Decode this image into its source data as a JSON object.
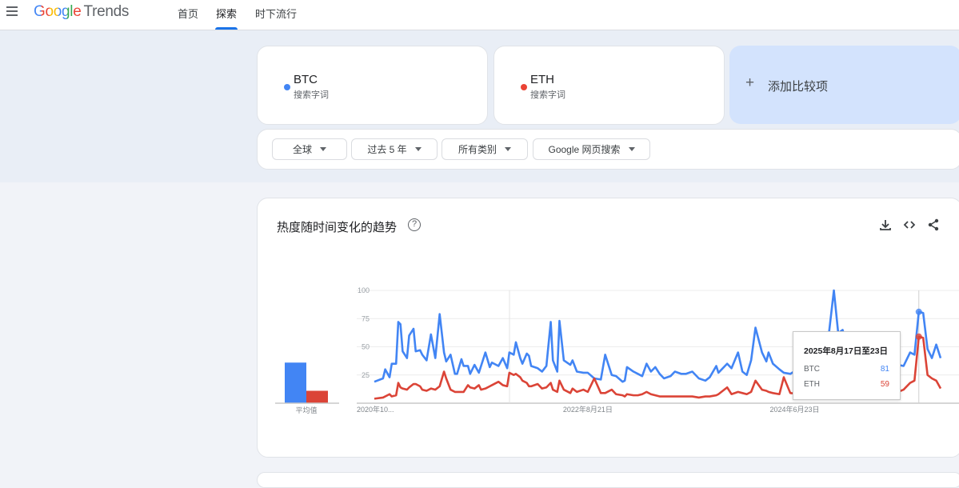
{
  "header": {
    "brand_google": "Google",
    "brand_trends": "Trends",
    "nav": [
      "首页",
      "探索",
      "时下流行"
    ],
    "active_nav": 1
  },
  "terms": [
    {
      "name": "BTC",
      "sub": "搜索字词",
      "color": "#4285f4"
    },
    {
      "name": "ETH",
      "sub": "搜索字词",
      "color": "#ea4335"
    }
  ],
  "add_compare": {
    "icon": "plus-icon",
    "label": "添加比较项"
  },
  "filters": [
    "全球",
    "过去 5 年",
    "所有类别",
    "Google 网页搜索"
  ],
  "trend_card": {
    "title": "热度随时间变化的趋势",
    "help": "?",
    "actions": [
      "download-icon",
      "embed-icon",
      "share-icon"
    ]
  },
  "tooltip": {
    "date": "2025年8月17日至23日",
    "rows": [
      {
        "name": "BTC",
        "value": "81"
      },
      {
        "name": "ETH",
        "value": "59"
      }
    ]
  },
  "chart_data": {
    "type": "line",
    "title": "热度随时间变化的趋势",
    "xlabel": "",
    "ylabel": "",
    "ylim": [
      0,
      100
    ],
    "yticks": [
      "100",
      "75",
      "50",
      "25"
    ],
    "xticks": [
      {
        "week": 0,
        "label": "2020年10..."
      },
      {
        "week": 98,
        "label": "2022年8月21日"
      },
      {
        "week": 193,
        "label": "2024年6月23日"
      }
    ],
    "x_weeks_total": 260,
    "hover_week": 250,
    "grid": true,
    "average": {
      "label": "平均值",
      "values": [
        {
          "name": "BTC",
          "value": 36
        },
        {
          "name": "ETH",
          "value": 11
        }
      ]
    },
    "series": [
      {
        "name": "BTC",
        "color": "#4285f4",
        "points": [
          [
            0,
            19
          ],
          [
            4,
            22
          ],
          [
            5,
            30
          ],
          [
            7,
            23
          ],
          [
            8,
            35
          ],
          [
            10,
            35
          ],
          [
            11,
            72
          ],
          [
            12,
            70
          ],
          [
            13,
            46
          ],
          [
            15,
            40
          ],
          [
            16,
            60
          ],
          [
            18,
            66
          ],
          [
            19,
            46
          ],
          [
            21,
            47
          ],
          [
            22,
            43
          ],
          [
            24,
            38
          ],
          [
            26,
            61
          ],
          [
            28,
            40
          ],
          [
            30,
            79
          ],
          [
            32,
            45
          ],
          [
            33,
            37
          ],
          [
            35,
            43
          ],
          [
            37,
            26
          ],
          [
            38,
            26
          ],
          [
            40,
            39
          ],
          [
            41,
            33
          ],
          [
            43,
            33
          ],
          [
            44,
            26
          ],
          [
            46,
            34
          ],
          [
            48,
            27
          ],
          [
            49,
            33
          ],
          [
            51,
            45
          ],
          [
            53,
            32
          ],
          [
            54,
            36
          ],
          [
            57,
            33
          ],
          [
            59,
            40
          ],
          [
            61,
            31
          ],
          [
            62,
            45
          ],
          [
            64,
            43
          ],
          [
            65,
            54
          ],
          [
            67,
            40
          ],
          [
            68,
            35
          ],
          [
            70,
            44
          ],
          [
            71,
            42
          ],
          [
            72,
            33
          ],
          [
            75,
            31
          ],
          [
            77,
            28
          ],
          [
            79,
            33
          ],
          [
            81,
            72
          ],
          [
            82,
            38
          ],
          [
            84,
            28
          ],
          [
            85,
            73
          ],
          [
            87,
            38
          ],
          [
            90,
            34
          ],
          [
            91,
            38
          ],
          [
            93,
            28
          ],
          [
            96,
            27
          ],
          [
            98,
            27
          ],
          [
            101,
            22
          ],
          [
            104,
            21
          ],
          [
            106,
            43
          ],
          [
            109,
            25
          ],
          [
            111,
            24
          ],
          [
            114,
            19
          ],
          [
            115,
            20
          ],
          [
            116,
            32
          ],
          [
            119,
            28
          ],
          [
            121,
            26
          ],
          [
            123,
            24
          ],
          [
            125,
            35
          ],
          [
            127,
            28
          ],
          [
            129,
            32
          ],
          [
            131,
            26
          ],
          [
            133,
            22
          ],
          [
            136,
            24
          ],
          [
            138,
            28
          ],
          [
            141,
            26
          ],
          [
            143,
            26
          ],
          [
            146,
            28
          ],
          [
            149,
            22
          ],
          [
            152,
            20
          ],
          [
            154,
            23
          ],
          [
            157,
            33
          ],
          [
            158,
            27
          ],
          [
            162,
            35
          ],
          [
            164,
            31
          ],
          [
            167,
            45
          ],
          [
            169,
            28
          ],
          [
            171,
            25
          ],
          [
            173,
            38
          ],
          [
            175,
            67
          ],
          [
            178,
            45
          ],
          [
            180,
            37
          ],
          [
            181,
            45
          ],
          [
            183,
            35
          ],
          [
            186,
            30
          ],
          [
            188,
            27
          ],
          [
            191,
            26
          ],
          [
            196,
            32
          ],
          [
            201,
            38
          ],
          [
            207,
            33
          ],
          [
            211,
            100
          ],
          [
            213,
            62
          ],
          [
            215,
            65
          ],
          [
            218,
            45
          ],
          [
            222,
            40
          ],
          [
            227,
            38
          ],
          [
            233,
            42
          ],
          [
            238,
            35
          ],
          [
            243,
            33
          ],
          [
            246,
            45
          ],
          [
            248,
            43
          ],
          [
            250,
            81
          ],
          [
            252,
            80
          ],
          [
            254,
            48
          ],
          [
            256,
            40
          ],
          [
            258,
            52
          ],
          [
            260,
            40
          ]
        ]
      },
      {
        "name": "ETH",
        "color": "#db4437",
        "points": [
          [
            0,
            4
          ],
          [
            4,
            5
          ],
          [
            7,
            8
          ],
          [
            8,
            6
          ],
          [
            10,
            7
          ],
          [
            11,
            18
          ],
          [
            12,
            14
          ],
          [
            13,
            13
          ],
          [
            15,
            12
          ],
          [
            16,
            14
          ],
          [
            18,
            17
          ],
          [
            19,
            17
          ],
          [
            21,
            15
          ],
          [
            22,
            12
          ],
          [
            24,
            11
          ],
          [
            26,
            13
          ],
          [
            28,
            12
          ],
          [
            30,
            15
          ],
          [
            32,
            28
          ],
          [
            33,
            22
          ],
          [
            35,
            12
          ],
          [
            37,
            10
          ],
          [
            38,
            10
          ],
          [
            40,
            10
          ],
          [
            41,
            10
          ],
          [
            43,
            16
          ],
          [
            44,
            14
          ],
          [
            46,
            13
          ],
          [
            48,
            16
          ],
          [
            49,
            12
          ],
          [
            51,
            13
          ],
          [
            53,
            15
          ],
          [
            54,
            16
          ],
          [
            57,
            19
          ],
          [
            59,
            16
          ],
          [
            61,
            15
          ],
          [
            62,
            27
          ],
          [
            64,
            25
          ],
          [
            65,
            26
          ],
          [
            67,
            23
          ],
          [
            68,
            20
          ],
          [
            70,
            18
          ],
          [
            71,
            15
          ],
          [
            72,
            15
          ],
          [
            75,
            17
          ],
          [
            77,
            13
          ],
          [
            79,
            14
          ],
          [
            81,
            18
          ],
          [
            82,
            12
          ],
          [
            84,
            10
          ],
          [
            85,
            20
          ],
          [
            87,
            12
          ],
          [
            90,
            9
          ],
          [
            91,
            13
          ],
          [
            93,
            10
          ],
          [
            96,
            12
          ],
          [
            98,
            10
          ],
          [
            101,
            22
          ],
          [
            104,
            9
          ],
          [
            106,
            9
          ],
          [
            109,
            12
          ],
          [
            111,
            8
          ],
          [
            114,
            7
          ],
          [
            115,
            6
          ],
          [
            116,
            8
          ],
          [
            119,
            7
          ],
          [
            121,
            7
          ],
          [
            123,
            8
          ],
          [
            125,
            10
          ],
          [
            127,
            8
          ],
          [
            129,
            7
          ],
          [
            131,
            6
          ],
          [
            133,
            6
          ],
          [
            136,
            6
          ],
          [
            138,
            6
          ],
          [
            141,
            6
          ],
          [
            143,
            6
          ],
          [
            146,
            6
          ],
          [
            149,
            5
          ],
          [
            152,
            6
          ],
          [
            154,
            6
          ],
          [
            157,
            7
          ],
          [
            158,
            8
          ],
          [
            162,
            14
          ],
          [
            164,
            8
          ],
          [
            167,
            10
          ],
          [
            169,
            9
          ],
          [
            171,
            8
          ],
          [
            173,
            10
          ],
          [
            175,
            20
          ],
          [
            178,
            12
          ],
          [
            180,
            11
          ],
          [
            181,
            10
          ],
          [
            183,
            9
          ],
          [
            186,
            8
          ],
          [
            188,
            23
          ],
          [
            191,
            9
          ],
          [
            196,
            8
          ],
          [
            201,
            12
          ],
          [
            207,
            9
          ],
          [
            211,
            14
          ],
          [
            213,
            10
          ],
          [
            215,
            12
          ],
          [
            218,
            10
          ],
          [
            222,
            12
          ],
          [
            227,
            10
          ],
          [
            233,
            9
          ],
          [
            238,
            8
          ],
          [
            243,
            12
          ],
          [
            246,
            18
          ],
          [
            248,
            20
          ],
          [
            250,
            59
          ],
          [
            252,
            58
          ],
          [
            254,
            25
          ],
          [
            256,
            22
          ],
          [
            258,
            20
          ],
          [
            260,
            13
          ]
        ]
      }
    ]
  }
}
